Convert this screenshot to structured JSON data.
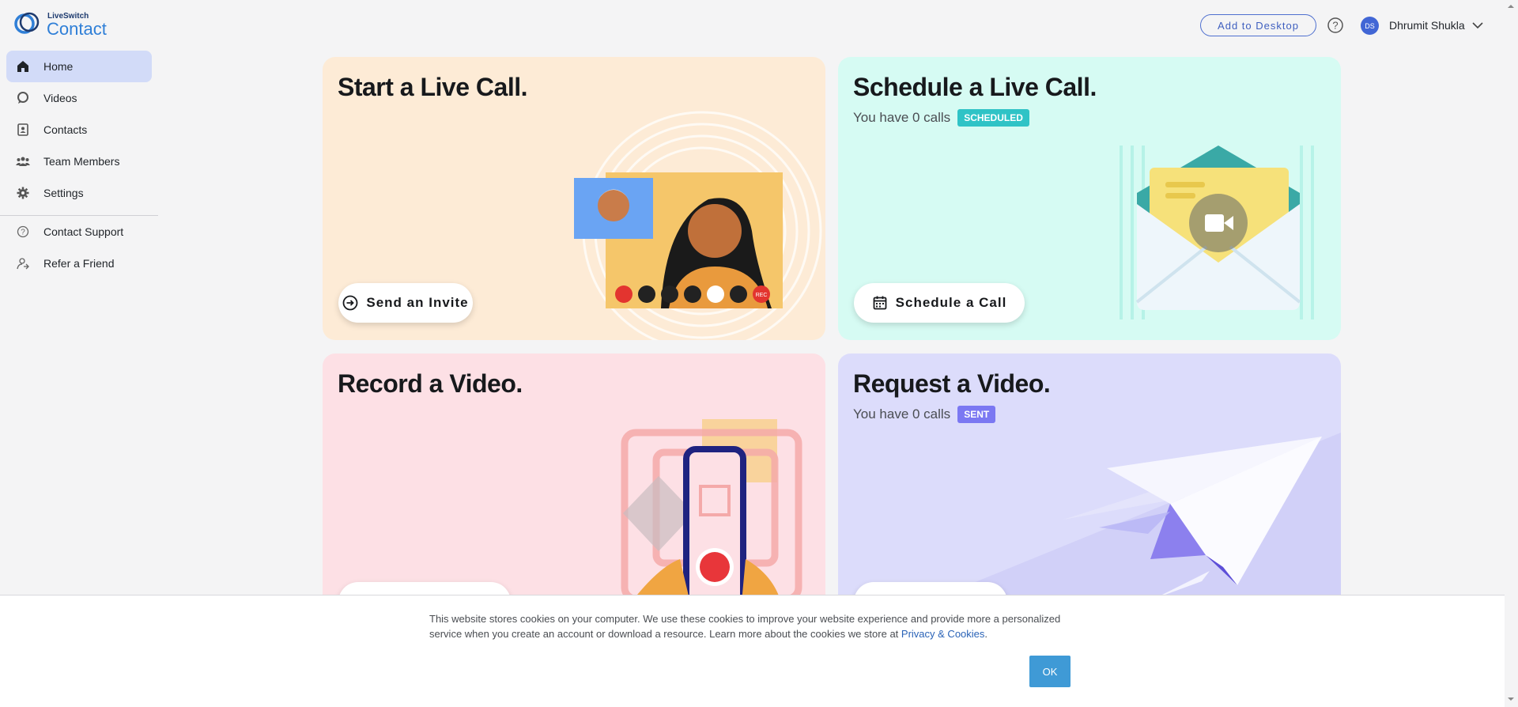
{
  "brand": {
    "small": "LiveSwitch",
    "big": "Contact"
  },
  "sidebar": {
    "items": [
      {
        "label": "Home",
        "icon": "home-icon"
      },
      {
        "label": "Videos",
        "icon": "chat-bubble-icon"
      },
      {
        "label": "Contacts",
        "icon": "contact-card-icon"
      },
      {
        "label": "Team Members",
        "icon": "team-icon"
      },
      {
        "label": "Settings",
        "icon": "gear-icon"
      }
    ],
    "support_items": [
      {
        "label": "Contact Support",
        "icon": "help-circle-icon"
      },
      {
        "label": "Refer a Friend",
        "icon": "refer-icon"
      }
    ]
  },
  "topbar": {
    "add_desktop": "Add to Desktop",
    "avatar_initials": "DS",
    "user_name": "Dhrumit Shukla"
  },
  "cards": {
    "start_call": {
      "title": "Start a Live Call.",
      "button": "Send an Invite",
      "controls_rec": "REC"
    },
    "schedule_call": {
      "title": "Schedule a Live Call.",
      "sub": "You have 0 calls",
      "badge": "SCHEDULED",
      "button": "Schedule a Call"
    },
    "record_video": {
      "title": "Record a Video."
    },
    "request_video": {
      "title": "Request a Video.",
      "sub": "You have 0 calls",
      "badge": "SENT"
    }
  },
  "cookie": {
    "text": "This website stores cookies on your computer. We use these cookies to improve your website experience and provide more a personalized service when you create an account or download a resource. Learn more about the cookies we store at",
    "link": "Privacy & Cookies",
    "after_link": ".",
    "ok": "OK"
  },
  "colors": {
    "accent": "#4166d5",
    "start_call_bg": "#fdebd6",
    "schedule_call_bg": "#d6fbf3",
    "record_video_bg": "#fde0e5",
    "request_video_bg": "#dcdcfb",
    "scheduled_badge": "#2fc3c6",
    "sent_badge": "#7b78f2",
    "ok_button": "#3f9ad6"
  }
}
